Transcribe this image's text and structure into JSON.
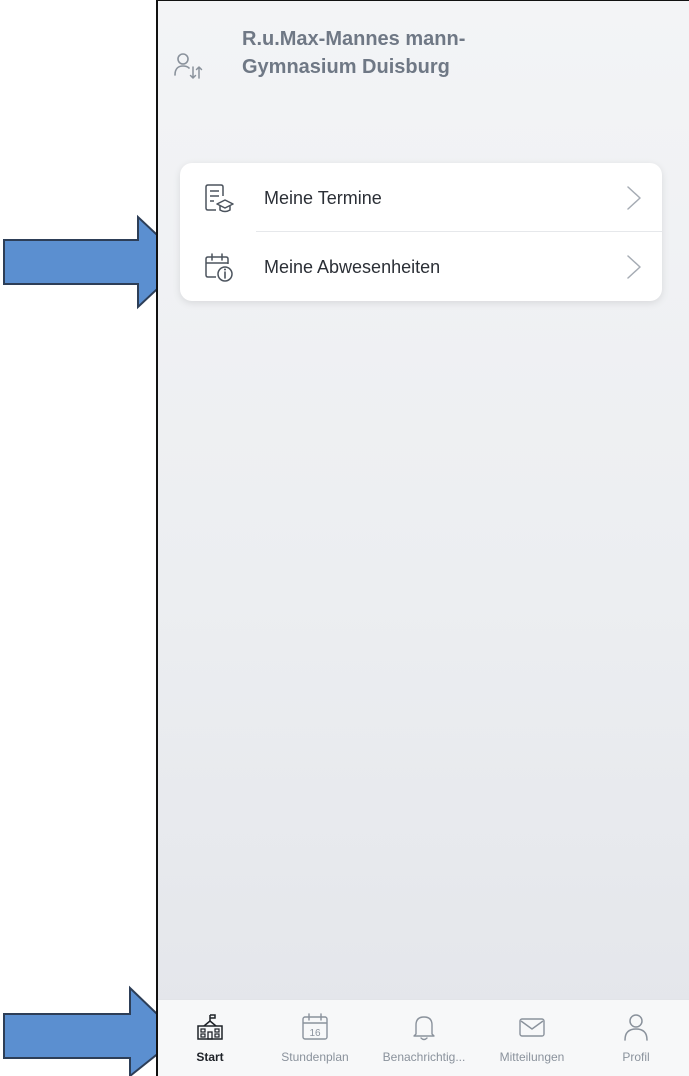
{
  "header": {
    "school_name": "R.u.Max-Mannes mann-Gymnasium Duisburg",
    "switch_icon": "user-switch-icon"
  },
  "menu": {
    "items": [
      {
        "label": "Meine Termine",
        "icon": "appointments-icon"
      },
      {
        "label": "Meine Abwesenheiten",
        "icon": "calendar-info-icon"
      }
    ]
  },
  "tabbar": {
    "tabs": [
      {
        "label": "Start",
        "icon": "school-icon",
        "active": true
      },
      {
        "label": "Stundenplan",
        "icon": "calendar-icon",
        "calendar_day": "16"
      },
      {
        "label": "Benachrichtig...",
        "icon": "bell-icon"
      },
      {
        "label": "Mitteilungen",
        "icon": "mail-icon"
      },
      {
        "label": "Profil",
        "icon": "profile-icon"
      }
    ]
  },
  "colors": {
    "accent_arrow": "#5b8fd0",
    "arrow_outline": "#2d3e57",
    "active_tab": "#1e2228",
    "inactive_tab": "#8a929c",
    "school_name": "#6f7885"
  }
}
